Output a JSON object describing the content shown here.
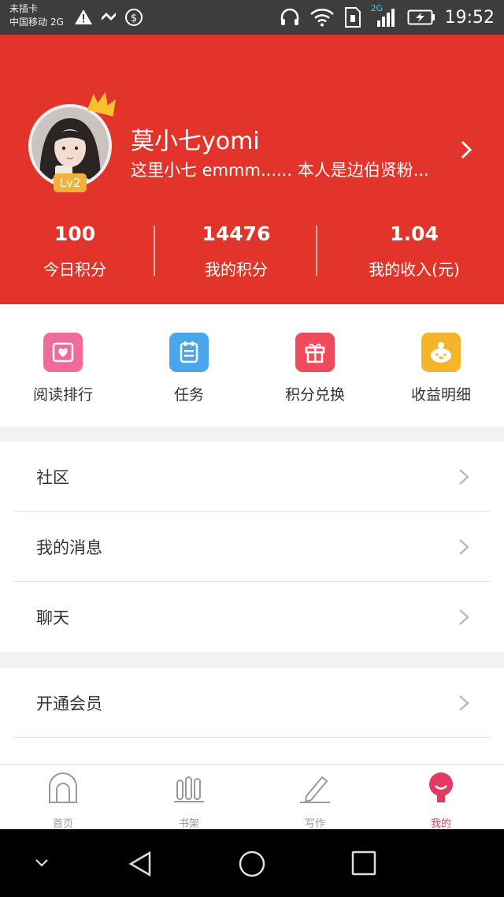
{
  "status_bar": {
    "carrier_line1": "未插卡",
    "carrier_line2": "中国移动",
    "network": "2G",
    "network_badge": "2G",
    "time": "19:52"
  },
  "profile": {
    "username": "莫小七yomi",
    "bio": "这里小七 emmm...... 本人是边伯贤粉...",
    "level": "Lv2"
  },
  "stats": [
    {
      "value": "100",
      "label": "今日积分"
    },
    {
      "value": "14476",
      "label": "我的积分"
    },
    {
      "value": "1.04",
      "label": "我的收入(元)"
    }
  ],
  "shortcuts": [
    {
      "label": "阅读排行",
      "icon": "heart-card-icon",
      "color": "#f06a9b"
    },
    {
      "label": "任务",
      "icon": "notepad-icon",
      "color": "#4aa6ec"
    },
    {
      "label": "积分兑换",
      "icon": "gift-icon",
      "color": "#ef4b5d"
    },
    {
      "label": "收益明细",
      "icon": "piggy-icon",
      "color": "#f5b52a"
    }
  ],
  "menu_group1": [
    {
      "label": "社区"
    },
    {
      "label": "我的消息"
    },
    {
      "label": "聊天"
    }
  ],
  "menu_group2": [
    {
      "label": "开通会员"
    }
  ],
  "bottom_nav": [
    {
      "label": "首页",
      "icon": "home-arch-icon"
    },
    {
      "label": "书架",
      "icon": "bookshelf-icon"
    },
    {
      "label": "写作",
      "icon": "pencil-icon"
    },
    {
      "label": "我的",
      "icon": "profile-icon",
      "active": true
    }
  ],
  "colors": {
    "header_red": "#e2342a",
    "active_pink": "#e33a5f",
    "level_badge": "#f1b13b"
  }
}
